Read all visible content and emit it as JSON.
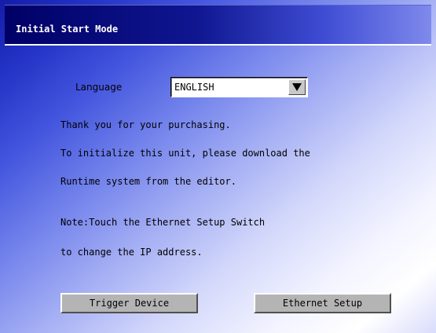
{
  "window": {
    "title": "Initial Start Mode"
  },
  "language": {
    "label": "Language",
    "selected": "ENGLISH"
  },
  "messages": {
    "line1": "Thank you for your purchasing.",
    "line2": "To initialize this unit, please download the",
    "line3": "Runtime system from the editor.",
    "note1": "Note:Touch the Ethernet Setup Switch",
    "note2": "to change the IP address."
  },
  "buttons": {
    "trigger_device": "Trigger Device",
    "ethernet_setup": "Ethernet Setup"
  },
  "colors": {
    "title_bar": "#0f1690",
    "background_dark": "#141ca8",
    "background_light": "#ffffff",
    "button_face": "#b4b4b4"
  },
  "icons": {
    "dropdown": "triangle-down-icon"
  }
}
